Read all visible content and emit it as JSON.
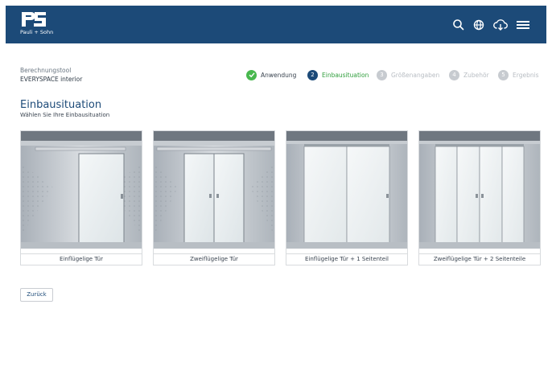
{
  "header": {
    "brand_logo_letters": "PS",
    "brand_name": "Pauli + Sohn",
    "icons": [
      "search-icon",
      "globe-icon",
      "cloud-download-icon",
      "menu-icon"
    ],
    "color": "#1c4a78"
  },
  "tool": {
    "name": "Berechnungstool",
    "product": "EVERYSPACE interior"
  },
  "steps": [
    {
      "num": "",
      "label": "Anwendung",
      "state": "done"
    },
    {
      "num": "2",
      "label": "Einbausituation",
      "state": "active"
    },
    {
      "num": "3",
      "label": "Größenangaben",
      "state": "todo"
    },
    {
      "num": "4",
      "label": "Zubehör",
      "state": "todo"
    },
    {
      "num": "5",
      "label": "Ergebnis",
      "state": "todo"
    }
  ],
  "page": {
    "title": "Einbausituation",
    "subtitle": "Wählen Sie Ihre Einbausituation"
  },
  "options": [
    {
      "label": "Einflügelige Tür"
    },
    {
      "label": "Zweiflügelige Tür"
    },
    {
      "label": "Einflügelige Tür + 1 Seitenteil"
    },
    {
      "label": "Zweiflügelige Tür + 2 Seitenteile"
    }
  ],
  "actions": {
    "back_label": "Zurück"
  },
  "colors": {
    "primary": "#1c4a78",
    "success": "#48b84e",
    "inactive": "#c7cbd0"
  }
}
